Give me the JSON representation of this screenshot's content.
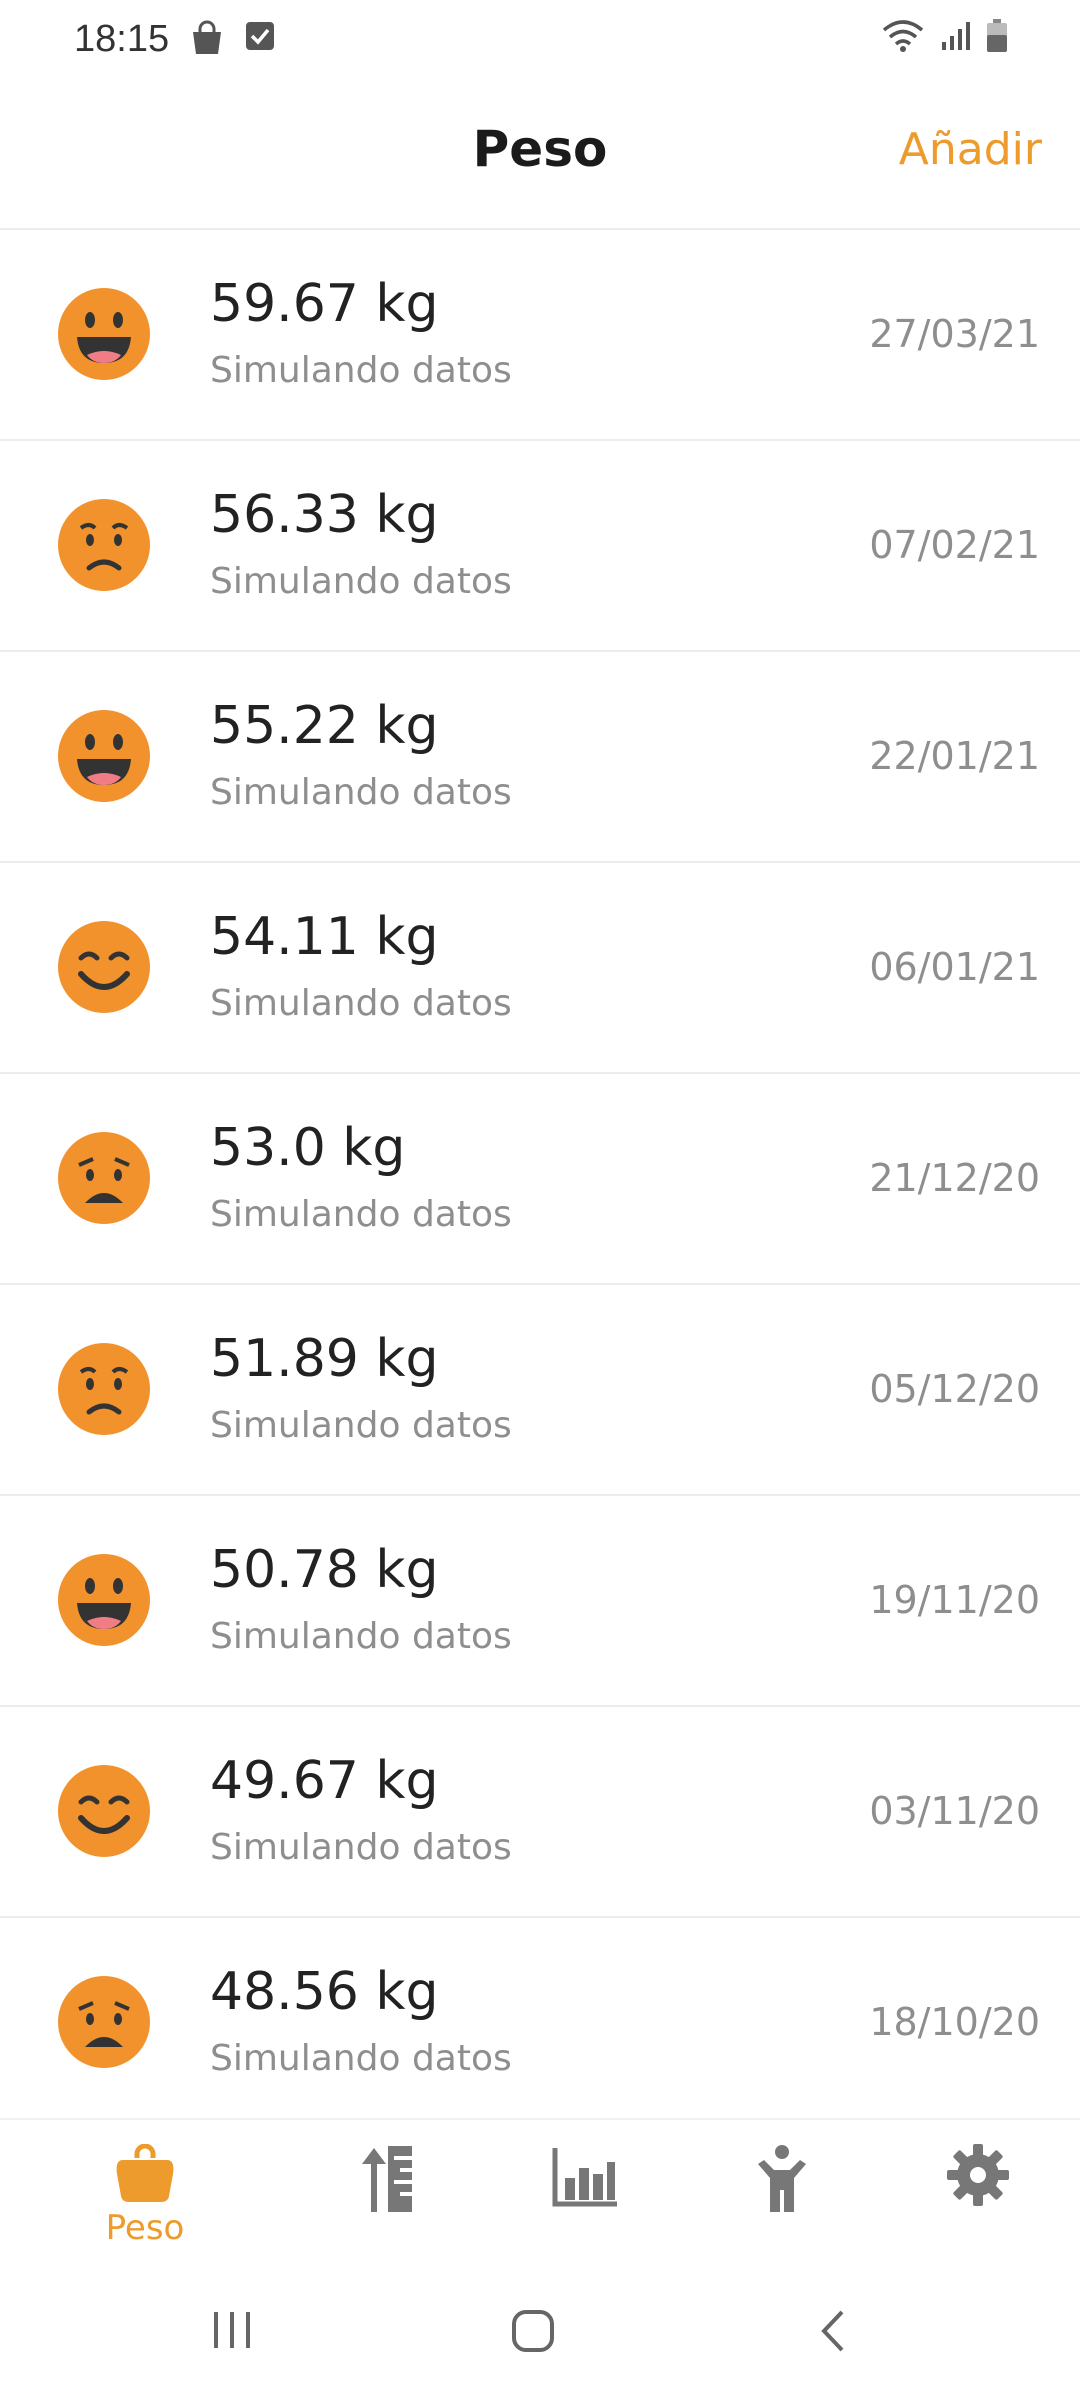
{
  "status_bar": {
    "time": "18:15",
    "left_icons": [
      "bag-icon",
      "checkbox-icon"
    ],
    "right_icons": [
      "wifi-icon",
      "signal-icon",
      "battery-icon"
    ]
  },
  "header": {
    "title": "Peso",
    "add_label": "Añadir",
    "accent_color": "#ED9B2C"
  },
  "entries": [
    {
      "weight": "59.67 kg",
      "subtitle": "Simulando datos",
      "date": "27/03/21",
      "mood": "grinning-face-icon"
    },
    {
      "weight": "56.33 kg",
      "subtitle": "Simulando datos",
      "date": "07/02/21",
      "mood": "worried-face-icon"
    },
    {
      "weight": "55.22 kg",
      "subtitle": "Simulando datos",
      "date": "22/01/21",
      "mood": "grinning-face-icon"
    },
    {
      "weight": "54.11 kg",
      "subtitle": "Simulando datos",
      "date": "06/01/21",
      "mood": "smiling-face-icon"
    },
    {
      "weight": "53.0 kg",
      "subtitle": "Simulando datos",
      "date": "21/12/20",
      "mood": "frowning-face-icon"
    },
    {
      "weight": "51.89 kg",
      "subtitle": "Simulando datos",
      "date": "05/12/20",
      "mood": "worried-face-icon"
    },
    {
      "weight": "50.78 kg",
      "subtitle": "Simulando datos",
      "date": "19/11/20",
      "mood": "grinning-face-icon"
    },
    {
      "weight": "49.67 kg",
      "subtitle": "Simulando datos",
      "date": "03/11/20",
      "mood": "smiling-face-icon"
    },
    {
      "weight": "48.56 kg",
      "subtitle": "Simulando datos",
      "date": "18/10/20",
      "mood": "frowning-face-icon"
    }
  ],
  "tab_bar": {
    "tabs": [
      {
        "label": "Peso",
        "icon": "weight-bag-icon",
        "active": true
      },
      {
        "label": "",
        "icon": "ruler-icon",
        "active": false
      },
      {
        "label": "",
        "icon": "bar-chart-icon",
        "active": false
      },
      {
        "label": "",
        "icon": "person-icon",
        "active": false
      },
      {
        "label": "",
        "icon": "gear-icon",
        "active": false
      }
    ],
    "active_color": "#ED9B2C",
    "inactive_color": "#777777"
  },
  "nav_bar": {
    "buttons": [
      "recent-apps-icon",
      "home-icon",
      "back-icon"
    ]
  }
}
